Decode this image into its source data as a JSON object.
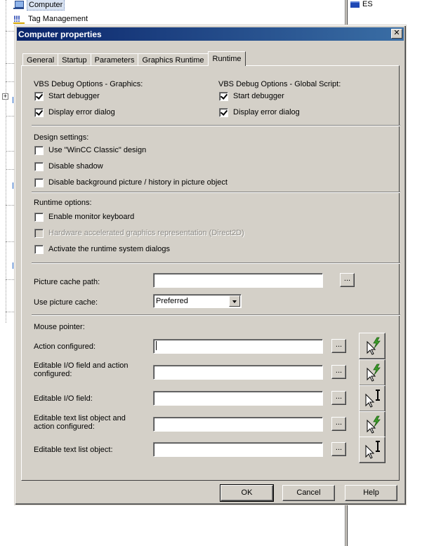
{
  "explorer": {
    "items": [
      {
        "label": "Computer",
        "icon": "computer-icon"
      },
      {
        "label": "Tag Management",
        "icon": "tag-management-icon"
      }
    ],
    "right_item": {
      "label": "ES"
    }
  },
  "dialog": {
    "title": "Computer properties",
    "close_glyph": "✕",
    "tabs": [
      "General",
      "Startup",
      "Parameters",
      "Graphics Runtime",
      "Runtime"
    ],
    "active_tab": "Runtime",
    "vbs_graphics": {
      "title": "VBS Debug Options - Graphics:",
      "start_debugger": {
        "label": "Start debugger",
        "checked": true
      },
      "display_error": {
        "label": "Display error dialog",
        "checked": true
      }
    },
    "vbs_global": {
      "title": "VBS Debug Options - Global Script:",
      "start_debugger": {
        "label": "Start debugger",
        "checked": true
      },
      "display_error": {
        "label": "Display error dialog",
        "checked": true
      }
    },
    "design": {
      "title": "Design settings:",
      "options": [
        {
          "label": "Use \"WinCC Classic\" design",
          "checked": false
        },
        {
          "label": "Disable shadow",
          "checked": false
        },
        {
          "label": "Disable background picture / history in picture object",
          "checked": false
        }
      ]
    },
    "runtime_options": {
      "title": "Runtime options:",
      "options": [
        {
          "label": "Enable monitor keyboard",
          "checked": false,
          "disabled": false
        },
        {
          "label": "Hardware accelerated graphics representation (Direct2D)",
          "checked": false,
          "disabled": true
        },
        {
          "label": "Activate the runtime system dialogs",
          "checked": false,
          "disabled": false
        }
      ]
    },
    "cache": {
      "path_label": "Picture cache path:",
      "path_value": "",
      "use_label": "Use picture cache:",
      "use_value": "Preferred"
    },
    "mouse_pointer": {
      "title": "Mouse pointer:",
      "rows": [
        {
          "label": "Action configured:",
          "value": "",
          "cursor": "action-cursor-icon"
        },
        {
          "label": "Editable I/O field and action configured:",
          "value": "",
          "cursor": "action-cursor-icon"
        },
        {
          "label": "Editable I/O field:",
          "value": "",
          "cursor": "ibeam-cursor-icon"
        },
        {
          "label": "Editable text list object and action configured:",
          "value": "",
          "cursor": "action-cursor-icon"
        },
        {
          "label": "Editable text list object:",
          "value": "",
          "cursor": "ibeam-cursor-icon"
        }
      ]
    },
    "browse_label": "...",
    "buttons": {
      "ok": "OK",
      "cancel": "Cancel",
      "help": "Help"
    }
  },
  "colors": {
    "titlebar_start": "#0a246a",
    "titlebar_end": "#3a6ea5",
    "face": "#d4d0c8",
    "cursor_accent": "#3ca02a"
  }
}
